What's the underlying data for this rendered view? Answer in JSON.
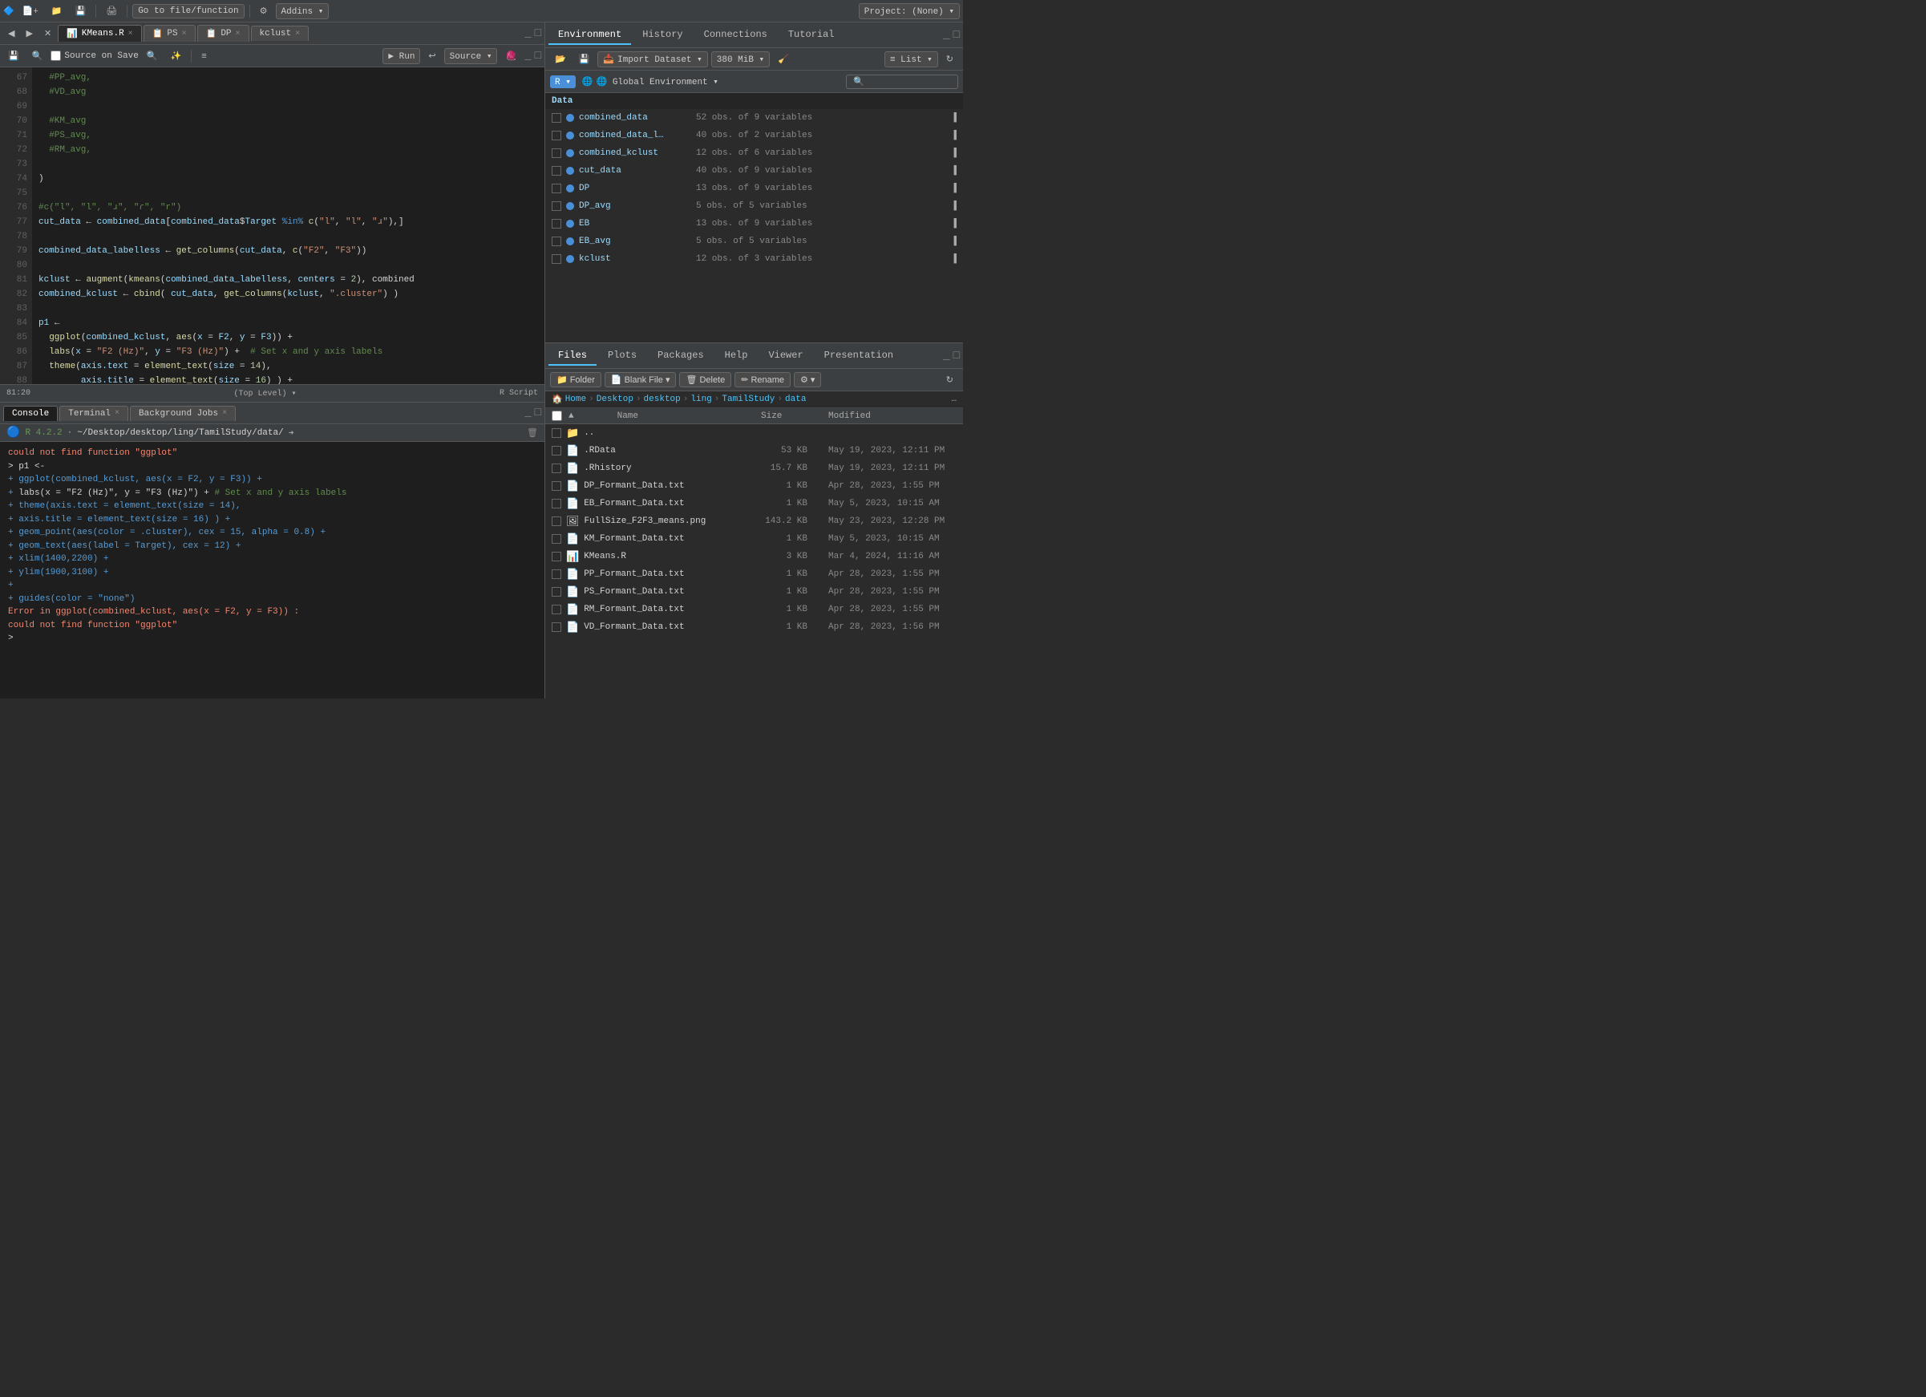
{
  "topbar": {
    "go_to_btn": "Go to file/function",
    "addins_btn": "Addins ▾",
    "project_btn": "Project: (None) ▾"
  },
  "editor": {
    "tabs": [
      {
        "id": "kmeans",
        "label": "KMeans.R",
        "active": true,
        "close": "×"
      },
      {
        "id": "ps",
        "label": "PS",
        "active": false,
        "close": "×"
      },
      {
        "id": "dp",
        "label": "DP",
        "active": false,
        "close": "×"
      },
      {
        "id": "kclust",
        "label": "kclust",
        "active": false,
        "close": "×"
      }
    ],
    "toolbar": {
      "source_on_save": "Source on Save",
      "run_btn": "▶ Run",
      "source_btn": "Source ▾"
    },
    "lines": [
      {
        "num": "67",
        "code": "  #PP_avg,",
        "type": "comment"
      },
      {
        "num": "68",
        "code": "  #VD_avg",
        "type": "comment"
      },
      {
        "num": "69",
        "code": "",
        "type": "blank"
      },
      {
        "num": "70",
        "code": "  #KM_avg",
        "type": "comment"
      },
      {
        "num": "71",
        "code": "  #PS_avg,",
        "type": "comment"
      },
      {
        "num": "72",
        "code": "  #RM_avg,",
        "type": "comment"
      },
      {
        "num": "73",
        "code": "",
        "type": "blank"
      },
      {
        "num": "74",
        "code": ")",
        "type": "normal"
      },
      {
        "num": "75",
        "code": "",
        "type": "blank"
      },
      {
        "num": "76",
        "code": "#c(\"l\", \"l\", \"ɹ\", \"ɾ\", \"r\")",
        "type": "comment"
      },
      {
        "num": "77",
        "code": "cut_data ← combined_data[combined_data$Target %in% c(\"l\", \"l\", \"ɹ\"),]",
        "type": "normal"
      },
      {
        "num": "78",
        "code": "",
        "type": "blank"
      },
      {
        "num": "79",
        "code": "combined_data_labelless ← get_columns(cut_data, c(\"F2\", \"F3\"))",
        "type": "normal"
      },
      {
        "num": "80",
        "code": "",
        "type": "blank"
      },
      {
        "num": "81",
        "code": "kclust ← augment(kmeans(combined_data_labelless, centers = 2), combined",
        "type": "normal"
      },
      {
        "num": "82",
        "code": "combined_kclust ← cbind( cut_data, get_columns(kclust, \".cluster\") )",
        "type": "normal"
      },
      {
        "num": "83",
        "code": "",
        "type": "blank"
      },
      {
        "num": "84",
        "code": "p1 ←",
        "type": "normal"
      },
      {
        "num": "85",
        "code": "  ggplot(combined_kclust, aes(x = F2, y = F3)) +",
        "type": "normal"
      },
      {
        "num": "86",
        "code": "  labs(x = \"F2 (Hz)\", y = \"F3 (Hz)\") +  # Set x and y axis labels",
        "type": "mixed"
      },
      {
        "num": "87",
        "code": "  theme(axis.text = element_text(size = 14),",
        "type": "normal"
      },
      {
        "num": "88",
        "code": "        axis.title = element_text(size = 16) ) +",
        "type": "normal"
      }
    ],
    "status": {
      "position": "81:20",
      "level": "(Top Level) ▾",
      "script_type": "R Script"
    }
  },
  "console": {
    "tabs": [
      {
        "label": "Console",
        "active": true,
        "close": ""
      },
      {
        "label": "Terminal",
        "active": false,
        "close": "×"
      },
      {
        "label": "Background Jobs",
        "active": false,
        "close": "×"
      }
    ],
    "header": {
      "r_version": "R 4.2.2",
      "path": "~/Desktop/desktop/ling/TamilStudy/data/"
    },
    "lines": [
      {
        "type": "error",
        "text": "could not find function \"ggplot\""
      },
      {
        "type": "prompt",
        "text": "> p1 ←"
      },
      {
        "type": "plus",
        "text": "+   ggplot(combined_kclust, aes(x = F2, y = F3)) +"
      },
      {
        "type": "plus",
        "text": "+   labs(x = \"F2 (Hz)\", y = \"F3 (Hz)\") +  # Set x and y axis labels"
      },
      {
        "type": "plus",
        "text": "+   theme(axis.text = element_text(size = 14),"
      },
      {
        "type": "plus",
        "text": "+         axis.title = element_text(size = 16) ) +"
      },
      {
        "type": "plus",
        "text": "+   geom_point(aes(color = .cluster), cex = 15, alpha = 0.8) +"
      },
      {
        "type": "plus",
        "text": "+   geom_text(aes(label = Target), cex = 12) +"
      },
      {
        "type": "plus",
        "text": "+   xlim(1400,2200) +"
      },
      {
        "type": "plus",
        "text": "+   ylim(1900,3100) +"
      },
      {
        "type": "plus",
        "text": "+"
      },
      {
        "type": "plus",
        "text": "+   guides(color = \"none\")"
      },
      {
        "type": "error",
        "text": "Error in ggplot(combined_kclust, aes(x = F2, y = F3)) :"
      },
      {
        "type": "error_detail",
        "text": "  could not find function \"ggplot\""
      },
      {
        "type": "prompt_empty",
        "text": "> "
      }
    ]
  },
  "environment": {
    "tabs": [
      {
        "label": "Environment",
        "active": true
      },
      {
        "label": "History",
        "active": false
      },
      {
        "label": "Connections",
        "active": false
      },
      {
        "label": "Tutorial",
        "active": false
      }
    ],
    "toolbar": {
      "import_btn": "Import Dataset ▾",
      "memory": "380 MiB ▾",
      "list_btn": "≡ List ▾"
    },
    "selector": {
      "r_label": "R ▾",
      "env_label": "🌐 Global Environment ▾"
    },
    "data_heading": "Data",
    "data_items": [
      {
        "name": "combined_data",
        "info": "52 obs. of 9 variables"
      },
      {
        "name": "combined_data_l…",
        "info": "40 obs. of 2 variables"
      },
      {
        "name": "combined_kclust",
        "info": "12 obs. of 6 variables"
      },
      {
        "name": "cut_data",
        "info": "40 obs. of 9 variables"
      },
      {
        "name": "DP",
        "info": "13 obs. of 9 variables"
      },
      {
        "name": "DP_avg",
        "info": "5 obs. of 5 variables"
      },
      {
        "name": "EB",
        "info": "13 obs. of 9 variables"
      },
      {
        "name": "EB_avg",
        "info": "5 obs. of 5 variables"
      },
      {
        "name": "kclust",
        "info": "12 obs. of 3 variables"
      }
    ]
  },
  "files": {
    "tabs": [
      {
        "label": "Files",
        "active": true
      },
      {
        "label": "Plots",
        "active": false
      },
      {
        "label": "Packages",
        "active": false
      },
      {
        "label": "Help",
        "active": false
      },
      {
        "label": "Viewer",
        "active": false
      },
      {
        "label": "Presentation",
        "active": false
      }
    ],
    "toolbar": {
      "folder_btn": "📁 Folder",
      "blank_file_btn": "📄 Blank File ▾",
      "delete_btn": "🗑 Delete",
      "rename_btn": "✏ Rename",
      "gear_btn": "⚙ ▾"
    },
    "breadcrumb": {
      "parts": [
        "🏠 Home",
        "Desktop",
        "desktop",
        "ling",
        "TamilStudy",
        "data"
      ]
    },
    "columns": {
      "name": "Name",
      "size": "Size",
      "modified": "Modified"
    },
    "items": [
      {
        "type": "folder",
        "name": "..",
        "size": "",
        "modified": ""
      },
      {
        "type": "file",
        "icon": "📄",
        "name": ".RData",
        "size": "53 KB",
        "modified": "May 19, 2023, 12:11 PM"
      },
      {
        "type": "file",
        "icon": "📄",
        "name": ".Rhistory",
        "size": "15.7 KB",
        "modified": "May 19, 2023, 12:11 PM"
      },
      {
        "type": "file",
        "icon": "📄",
        "name": "DP_Formant_Data.txt",
        "size": "1 KB",
        "modified": "Apr 28, 2023, 1:55 PM"
      },
      {
        "type": "file",
        "icon": "📄",
        "name": "EB_Formant_Data.txt",
        "size": "1 KB",
        "modified": "May 5, 2023, 10:15 AM"
      },
      {
        "type": "file",
        "icon": "🖼",
        "name": "FullSize_F2F3_means.png",
        "size": "143.2 KB",
        "modified": "May 23, 2023, 12:28 PM"
      },
      {
        "type": "file",
        "icon": "📄",
        "name": "KM_Formant_Data.txt",
        "size": "1 KB",
        "modified": "May 5, 2023, 10:15 AM"
      },
      {
        "type": "file",
        "icon": "📊",
        "name": "KMeans.R",
        "size": "3 KB",
        "modified": "Mar 4, 2024, 11:16 AM"
      },
      {
        "type": "file",
        "icon": "📄",
        "name": "PP_Formant_Data.txt",
        "size": "1 KB",
        "modified": "Apr 28, 2023, 1:55 PM"
      },
      {
        "type": "file",
        "icon": "📄",
        "name": "PS_Formant_Data.txt",
        "size": "1 KB",
        "modified": "Apr 28, 2023, 1:55 PM"
      },
      {
        "type": "file",
        "icon": "📄",
        "name": "RM_Formant_Data.txt",
        "size": "1 KB",
        "modified": "Apr 28, 2023, 1:55 PM"
      },
      {
        "type": "file",
        "icon": "📄",
        "name": "VD_Formant_Data.txt",
        "size": "1 KB",
        "modified": "Apr 28, 2023, 1:56 PM"
      }
    ]
  }
}
